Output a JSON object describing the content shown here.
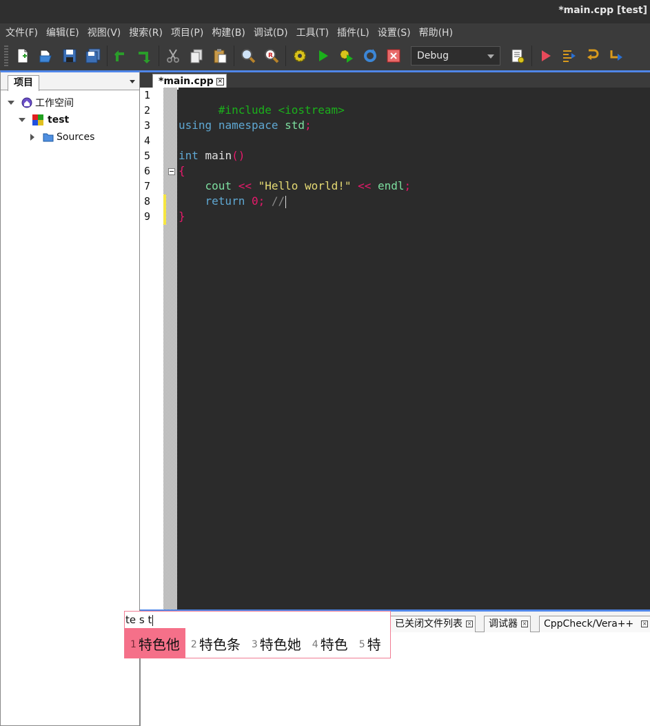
{
  "window": {
    "title": "*main.cpp [test]"
  },
  "menu": [
    "文件(F)",
    "编辑(E)",
    "视图(V)",
    "搜索(R)",
    "项目(P)",
    "构建(B)",
    "调试(D)",
    "工具(T)",
    "插件(L)",
    "设置(S)",
    "帮助(H)"
  ],
  "toolbar": {
    "build_config": "Debug"
  },
  "project_panel": {
    "tab_label": "项目",
    "tree": {
      "workspace": "工作空间",
      "project": "test",
      "folder": "Sources"
    }
  },
  "editor": {
    "tab_label": "*main.cpp",
    "line_numbers": [
      "1",
      "2",
      "3",
      "4",
      "5",
      "6",
      "7",
      "8",
      "9"
    ],
    "code": {
      "l1": "#include <iostream>",
      "l3_a": "using",
      "l3_b": "namespace",
      "l3_c": "std",
      "l3_d": ";",
      "l5_a": "int",
      "l5_b": "main",
      "l5_c": "()",
      "l6": "{",
      "l7_a": "cout",
      "l7_b": "<<",
      "l7_c": "\"Hello world!\"",
      "l7_d": "<<",
      "l7_e": "endl",
      "l7_f": ";",
      "l8_a": "return",
      "l8_b": "0",
      "l8_c": ";",
      "l8_d": "//",
      "l9": "}"
    }
  },
  "bottom_panel": {
    "tabs": [
      "已关闭文件列表",
      "调试器",
      "CppCheck/Vera++"
    ]
  },
  "ime": {
    "preedit": "te s t",
    "candidates": [
      {
        "num": "1",
        "text": "特色他"
      },
      {
        "num": "2",
        "text": "特色条"
      },
      {
        "num": "3",
        "text": "特色她"
      },
      {
        "num": "4",
        "text": "特色"
      },
      {
        "num": "5",
        "text": "特"
      }
    ]
  },
  "colors": {
    "accent": "#4f86e8",
    "ime_selected": "#f57089",
    "preprocessor": "#1bb01b",
    "keyword": "#5fa8d3",
    "string": "#e6db74",
    "operator": "#e8196b"
  }
}
